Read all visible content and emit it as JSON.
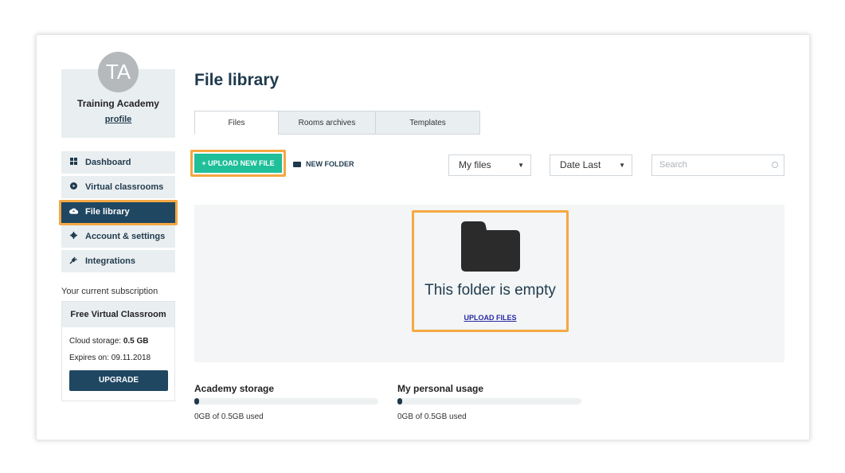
{
  "sidebar": {
    "avatar_initials": "TA",
    "org_name": "Training Academy",
    "profile_link": "profile",
    "nav": [
      {
        "label": "Dashboard",
        "icon": "grid-icon"
      },
      {
        "label": "Virtual classrooms",
        "icon": "play-circle-icon"
      },
      {
        "label": "File library",
        "icon": "cloud-upload-icon",
        "active": true
      },
      {
        "label": "Account & settings",
        "icon": "gear-icon"
      },
      {
        "label": "Integrations",
        "icon": "plug-icon"
      }
    ],
    "subscription_label": "Your current subscription",
    "plan_name": "Free Virtual Classroom",
    "storage_prefix": "Cloud storage:",
    "storage_value": "0.5 GB",
    "expires": "Expires on: 09.11.2018",
    "upgrade": "UPGRADE"
  },
  "main": {
    "title": "File library",
    "tabs": [
      "Files",
      "Rooms archives",
      "Templates"
    ],
    "upload_button": "UPLOAD NEW FILE",
    "new_folder": "NEW FOLDER",
    "filter_select": "My files",
    "sort_select": "Date Last",
    "search_placeholder": "Search",
    "empty_message": "This folder is empty",
    "upload_files_link": "UPLOAD FILES",
    "academy_storage": {
      "label": "Academy storage",
      "used": "0GB of 0.5GB used",
      "fraction": 0.0
    },
    "personal_usage": {
      "label": "My personal usage",
      "used": "0GB of 0.5GB used",
      "fraction": 0.0
    }
  },
  "colors": {
    "accent": "#1fbf9a",
    "navy": "#1f4762",
    "highlight": "#f5a842"
  }
}
